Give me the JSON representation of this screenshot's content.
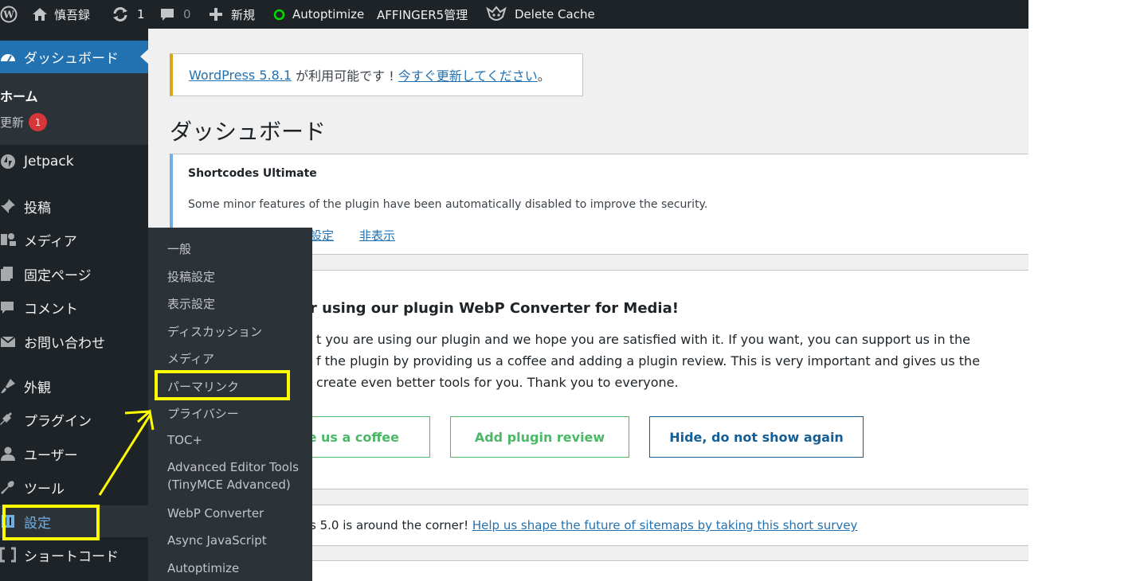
{
  "adminbar": {
    "site_name": "慎吾録",
    "updates_count": "1",
    "comments_count": "0",
    "new_label": "新規",
    "autoptimize_label": "Autoptimize",
    "affinger_label": "AFFINGER5管理",
    "delete_cache_label": "Delete Cache"
  },
  "sidebar": {
    "dashboard": "ダッシュボード",
    "home": "ホーム",
    "updates": "更新",
    "updates_badge": "1",
    "jetpack": "Jetpack",
    "posts": "投稿",
    "media": "メディア",
    "pages": "固定ページ",
    "comments": "コメント",
    "contact": "お問い合わせ",
    "appearance": "外観",
    "plugins": "プラグイン",
    "users": "ユーザー",
    "tools": "ツール",
    "settings": "設定",
    "shortcodes": "ショートコード"
  },
  "flyout": {
    "items": [
      "一般",
      "投稿設定",
      "表示設定",
      "ディスカッション",
      "メディア",
      "パーマリンク",
      "プライバシー",
      "TOC+",
      "Advanced Editor Tools",
      "(TinyMCE Advanced)",
      "WebP Converter",
      "Async JavaScript",
      "Autoptimize"
    ]
  },
  "notice_update": {
    "version_link": "WordPress 5.8.1",
    "middle_text": " が利用可能です ! ",
    "update_link": "今すぐ更新してください",
    "end": "。"
  },
  "page_title": "ダッシュボード",
  "su_notice": {
    "title": "Shortcodes Ultimate",
    "body": "Some minor features of the plugin have been automatically disabled to improve the security.",
    "settings_link": "設定",
    "hide_link": "非表示"
  },
  "webp_notice": {
    "title": "r using our plugin WebP Converter for Media!",
    "line1": "t you are using our plugin and we hope you are satisfied with it. If you want, you can support us in the",
    "line2": "f the plugin by providing us a coffee and adding a plugin review. This is very important and gives us the",
    "line3": "create even better tools for you. Thank you to everyone.",
    "btn_coffee": "de us a coffee",
    "btn_review": "Add plugin review",
    "btn_hide": "Hide, do not show again"
  },
  "sitemap_notice": {
    "text": "s 5.0 is around the corner! ",
    "link": "Help us shape the future of sitemaps by taking this short survey"
  },
  "colors": {
    "accent": "#2271b1",
    "highlight": "#ffff00",
    "green": "#4ab866",
    "badge": "#d63638"
  }
}
